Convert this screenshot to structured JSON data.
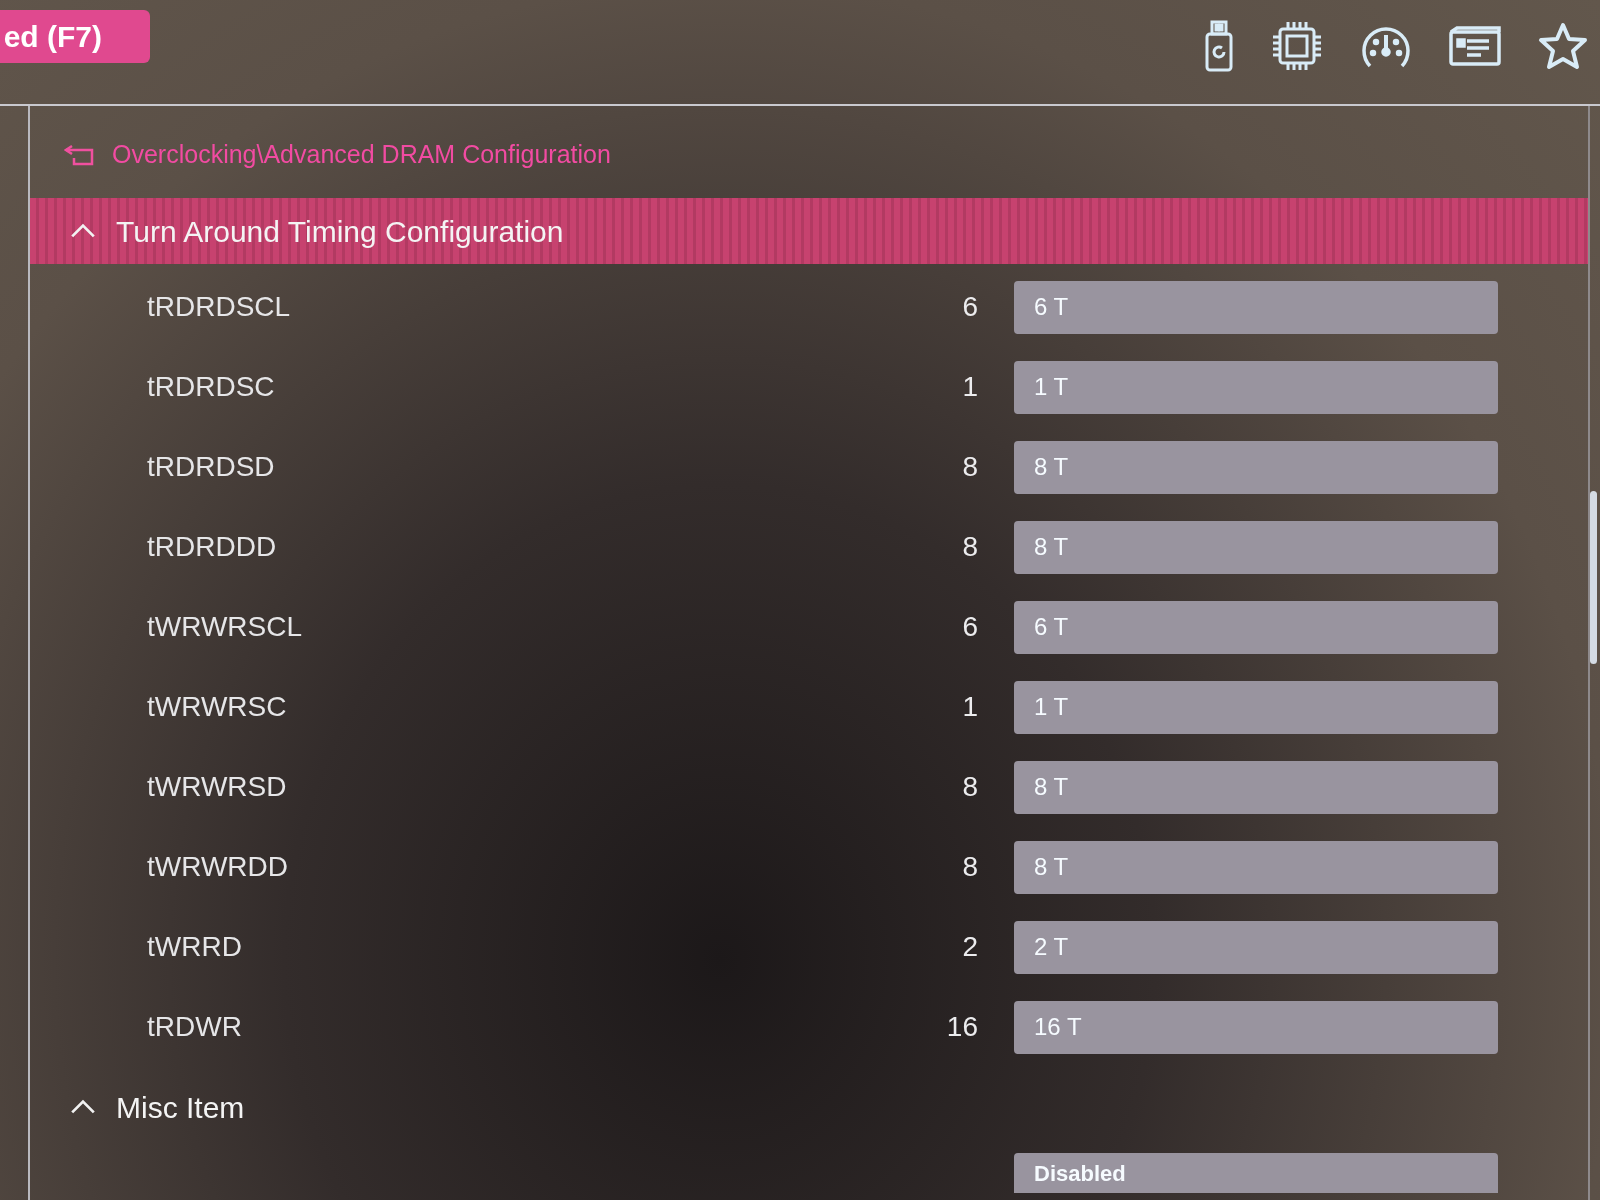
{
  "top_bar": {
    "mode_button": "ed (F7)"
  },
  "breadcrumb": "Overclocking\\Advanced DRAM Configuration",
  "sections": [
    {
      "title": "Turn Around Timing Configuration",
      "expanded": true,
      "selected": true,
      "items": [
        {
          "name": "tRDRDSCL",
          "current": "6",
          "value": "6 T"
        },
        {
          "name": "tRDRDSC",
          "current": "1",
          "value": "1 T"
        },
        {
          "name": "tRDRDSD",
          "current": "8",
          "value": "8 T"
        },
        {
          "name": "tRDRDDD",
          "current": "8",
          "value": "8 T"
        },
        {
          "name": "tWRWRSCL",
          "current": "6",
          "value": "6 T"
        },
        {
          "name": "tWRWRSC",
          "current": "1",
          "value": "1 T"
        },
        {
          "name": "tWRWRSD",
          "current": "8",
          "value": "8 T"
        },
        {
          "name": "tWRWRDD",
          "current": "8",
          "value": "8 T"
        },
        {
          "name": "tWRRD",
          "current": "2",
          "value": "2 T"
        },
        {
          "name": "tRDWR",
          "current": "16",
          "value": "16 T"
        }
      ]
    },
    {
      "title": "Misc Item",
      "expanded": true,
      "selected": false,
      "items": [
        {
          "value": "Disabled"
        }
      ]
    }
  ]
}
